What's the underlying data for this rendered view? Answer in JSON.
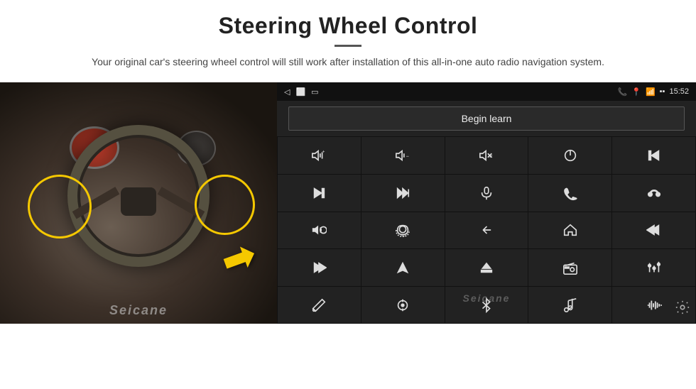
{
  "header": {
    "title": "Steering Wheel Control",
    "divider": true,
    "subtitle": "Your original car's steering wheel control will still work after installation of this all-in-one auto radio navigation system."
  },
  "statusbar": {
    "left_icons": [
      "◁",
      "⬜",
      "▭"
    ],
    "right_icons": [
      "📞",
      "📍",
      "📶",
      "15:52"
    ],
    "battery_signal": "▪▪"
  },
  "begin_learn_button": "Begin learn",
  "control_grid": {
    "rows": [
      [
        {
          "icon": "vol-up",
          "unicode": "🔊+"
        },
        {
          "icon": "vol-down",
          "unicode": "🔊−"
        },
        {
          "icon": "vol-mute",
          "unicode": "🔇"
        },
        {
          "icon": "power",
          "unicode": "⏻"
        },
        {
          "icon": "prev-track",
          "unicode": "⏮"
        }
      ],
      [
        {
          "icon": "next-track",
          "unicode": "⏭"
        },
        {
          "icon": "fast-forward",
          "unicode": "⏩"
        },
        {
          "icon": "mic",
          "unicode": "🎙"
        },
        {
          "icon": "phone",
          "unicode": "📞"
        },
        {
          "icon": "hang-up",
          "unicode": "📵"
        }
      ],
      [
        {
          "icon": "speaker",
          "unicode": "📢"
        },
        {
          "icon": "camera-360",
          "unicode": "🔄"
        },
        {
          "icon": "back",
          "unicode": "↩"
        },
        {
          "icon": "home",
          "unicode": "⌂"
        },
        {
          "icon": "skip-back",
          "unicode": "⏮"
        }
      ],
      [
        {
          "icon": "skip-forward",
          "unicode": "⏭"
        },
        {
          "icon": "navigate",
          "unicode": "➤"
        },
        {
          "icon": "eject",
          "unicode": "⏏"
        },
        {
          "icon": "radio",
          "unicode": "📻"
        },
        {
          "icon": "equalizer",
          "unicode": "🎚"
        }
      ],
      [
        {
          "icon": "pen",
          "unicode": "✏"
        },
        {
          "icon": "settings-knob",
          "unicode": "⚙"
        },
        {
          "icon": "bluetooth",
          "unicode": "⚡"
        },
        {
          "icon": "music",
          "unicode": "🎵"
        },
        {
          "icon": "bars",
          "unicode": "▐▐▐"
        }
      ]
    ]
  },
  "watermark": "Seicane",
  "gear_icon": "⚙"
}
